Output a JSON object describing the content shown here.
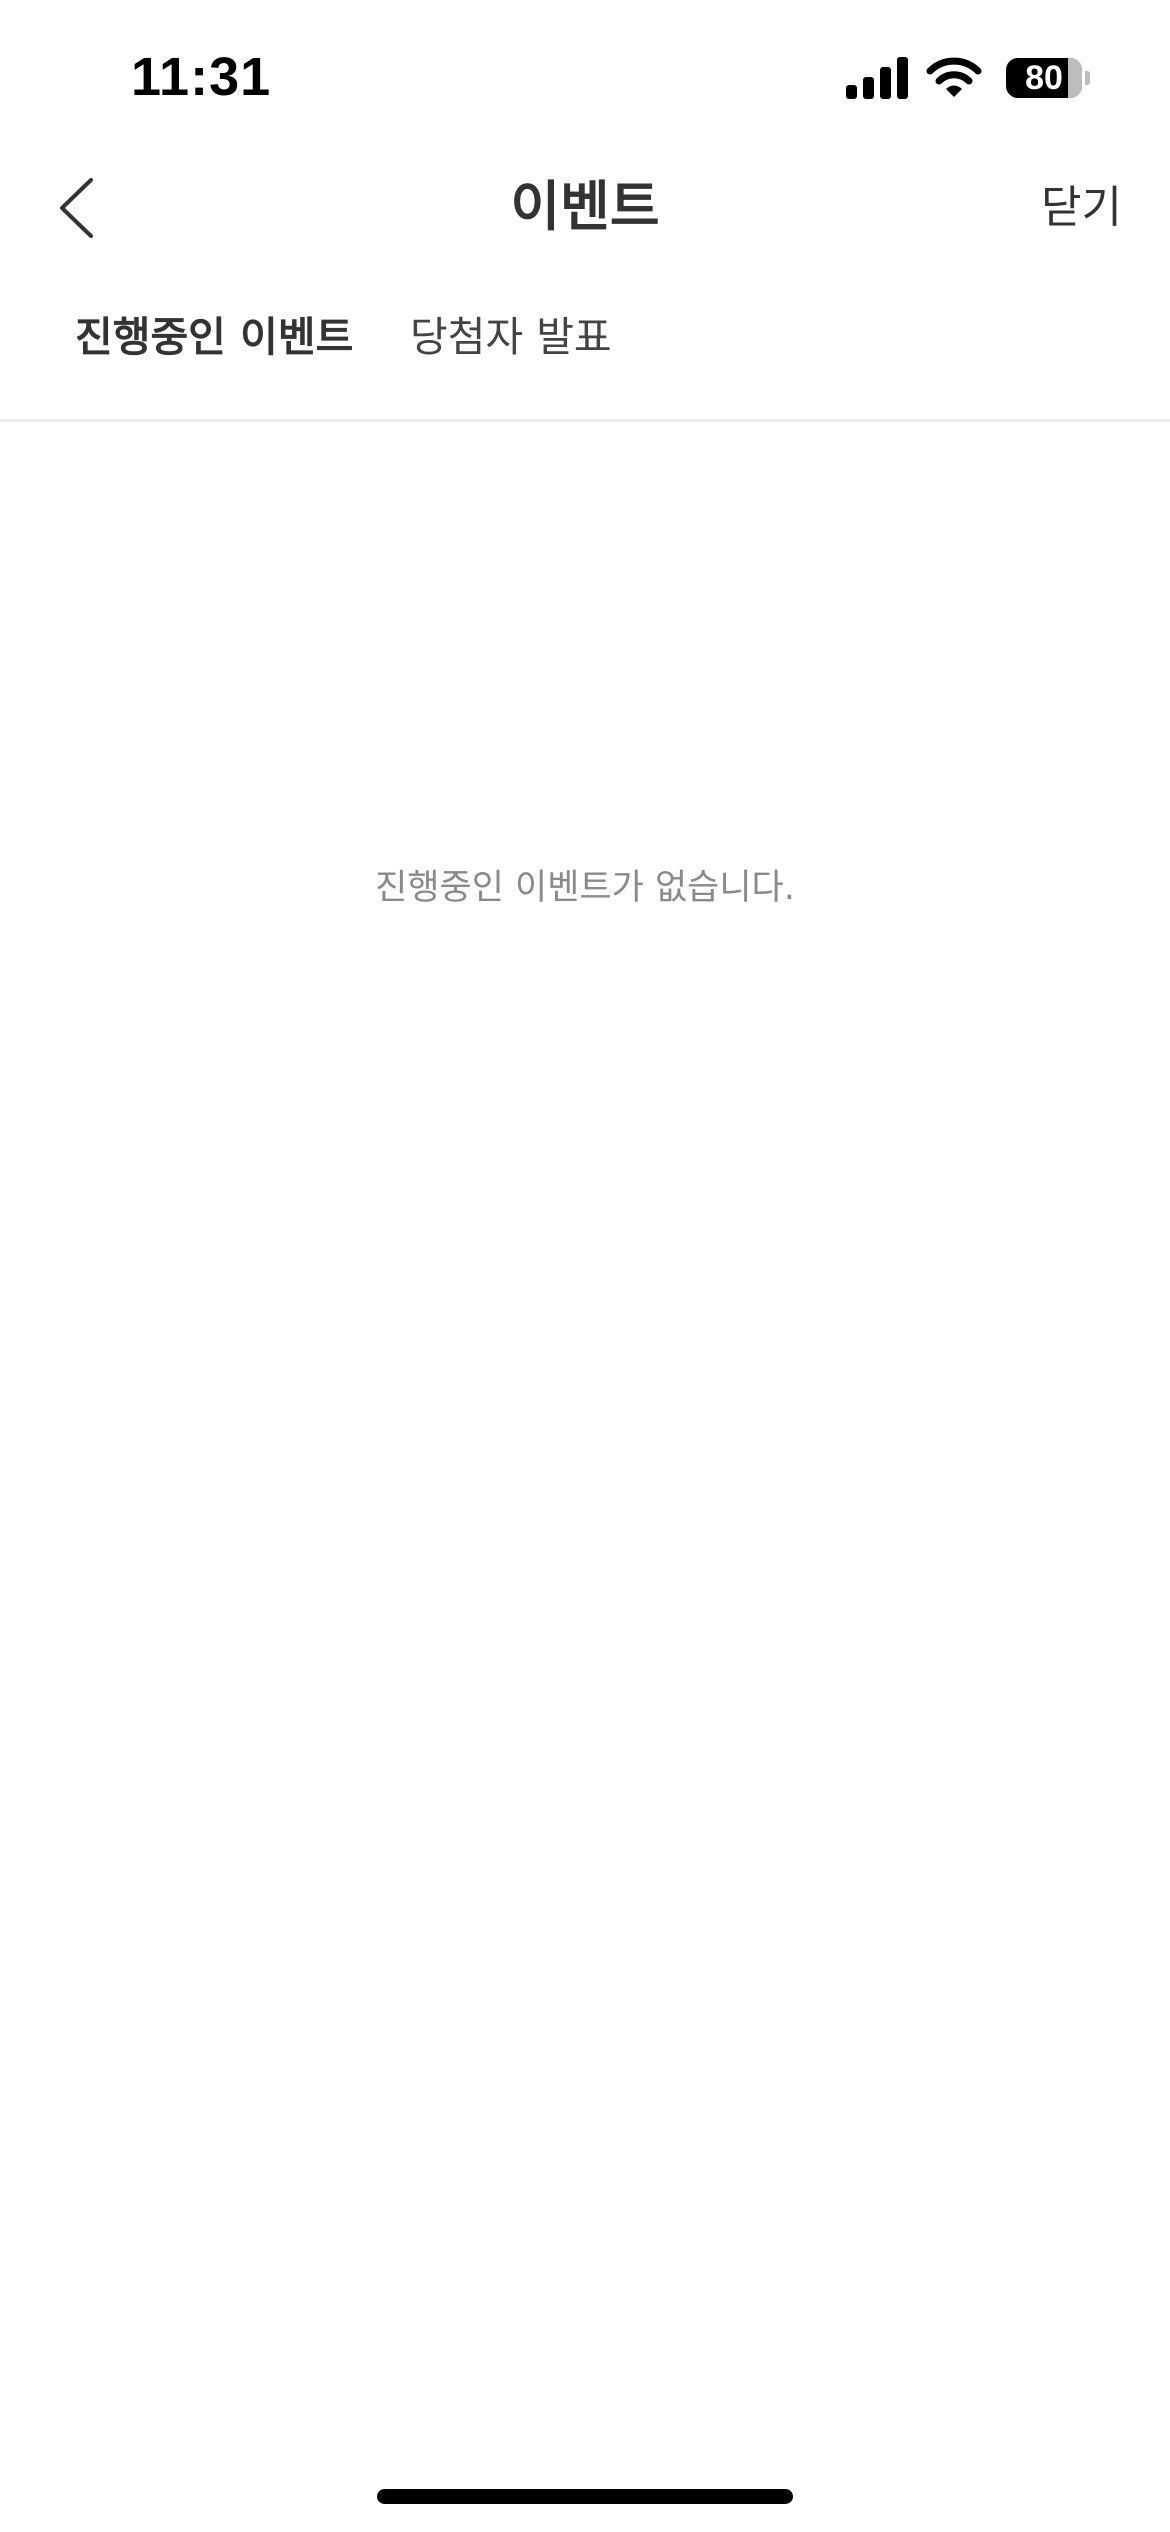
{
  "status_bar": {
    "time": "11:31",
    "battery_percent": "80",
    "signal_icon": "cellular-signal-icon",
    "wifi_icon": "wifi-icon"
  },
  "header": {
    "title": "이벤트",
    "close_label": "닫기",
    "back_icon": "chevron-left-icon"
  },
  "tabs": [
    {
      "label": "진행중인 이벤트",
      "selected": true
    },
    {
      "label": "당첨자 발표",
      "selected": false
    }
  ],
  "main": {
    "empty_message": "진행중인 이벤트가 없습니다."
  },
  "colors": {
    "text_primary": "#333333",
    "text_muted": "#8a8a8a",
    "divider": "#eeeeee",
    "background": "#ffffff"
  }
}
